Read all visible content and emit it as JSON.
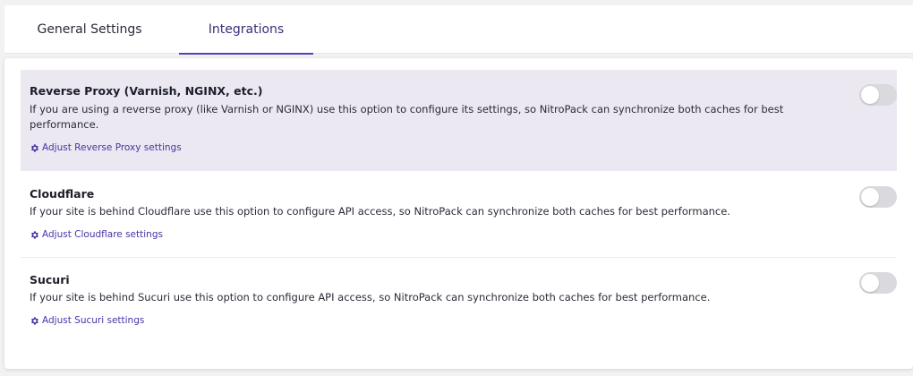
{
  "tabs": [
    {
      "label": "General Settings",
      "active": false
    },
    {
      "label": "Integrations",
      "active": true
    }
  ],
  "integrations": [
    {
      "title": "Reverse Proxy (Varnish, NGINX, etc.)",
      "description": "If you are using a reverse proxy (like Varnish or NGINX) use this option to configure its settings, so NitroPack can synchronize both caches for best performance.",
      "link": "Adjust Reverse Proxy settings",
      "enabled": false
    },
    {
      "title": "Cloudflare",
      "description": "If your site is behind Cloudflare use this option to configure API access, so NitroPack can synchronize both caches for best performance.",
      "link": "Adjust Cloudflare settings",
      "enabled": false
    },
    {
      "title": "Sucuri",
      "description": "If your site is behind Sucuri use this option to configure API access, so NitroPack can synchronize both caches for best performance.",
      "link": "Adjust Sucuri settings",
      "enabled": false
    }
  ],
  "colors": {
    "accent": "#5a3fb5",
    "link": "#4b32a6",
    "highlight_row": "#ebe8f1",
    "toggle_off": "#d9d9de"
  }
}
